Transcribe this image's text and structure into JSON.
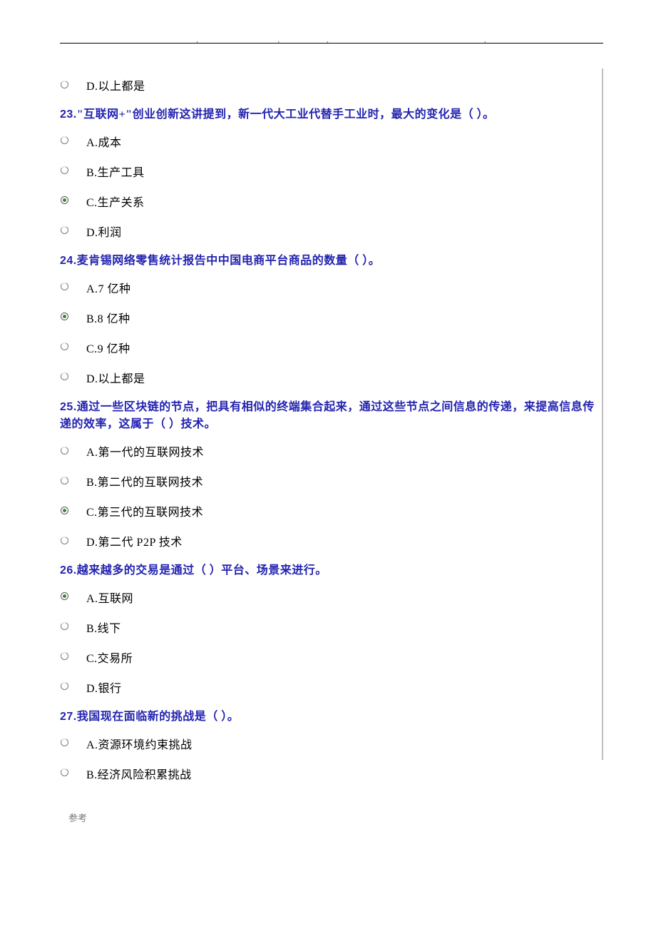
{
  "header": {
    "dots": [
      "·",
      "·",
      "·",
      "·"
    ]
  },
  "prev_tail_option": {
    "label": "D.以上都是",
    "selected": false
  },
  "questions": [
    {
      "num": "23.",
      "text": "\"互联网+\"创业创新这讲提到，新一代大工业代替手工业时，最大的变化是（ ）。",
      "options": [
        {
          "label": "A.成本",
          "selected": false
        },
        {
          "label": "B.生产工具",
          "selected": false
        },
        {
          "label": "C.生产关系",
          "selected": true
        },
        {
          "label": "D.利润",
          "selected": false
        }
      ]
    },
    {
      "num": "24.",
      "text": "麦肯锡网络零售统计报告中中国电商平台商品的数量（ ）。",
      "options": [
        {
          "label": "A.7 亿种",
          "selected": false
        },
        {
          "label": "B.8 亿种",
          "selected": true
        },
        {
          "label": "C.9 亿种",
          "selected": false
        },
        {
          "label": "D.以上都是",
          "selected": false
        }
      ]
    },
    {
      "num": "25.",
      "text": "通过一些区块链的节点，把具有相似的终端集合起来，通过这些节点之间信息的传递，来提高信息传递的效率，这属于（ ）技术。",
      "options": [
        {
          "label": "A.第一代的互联网技术",
          "selected": false
        },
        {
          "label": "B.第二代的互联网技术",
          "selected": false
        },
        {
          "label": "C.第三代的互联网技术",
          "selected": true
        },
        {
          "label": "D.第二代 P2P 技术",
          "selected": false
        }
      ]
    },
    {
      "num": "26.",
      "text": "越来越多的交易是通过（ ）平台、场景来进行。",
      "options": [
        {
          "label": "A.互联网",
          "selected": true
        },
        {
          "label": "B.线下",
          "selected": false
        },
        {
          "label": "C.交易所",
          "selected": false
        },
        {
          "label": "D.银行",
          "selected": false
        }
      ]
    },
    {
      "num": "27.",
      "text": "我国现在面临新的挑战是（ ）。",
      "options": [
        {
          "label": "A.资源环境约束挑战",
          "selected": false
        },
        {
          "label": "B.经济风险积累挑战",
          "selected": false
        }
      ]
    }
  ],
  "footer": {
    "text": "参考"
  },
  "svg": {
    "unchecked": "<svg width='13' height='13' viewBox='0 0 13 13'><circle cx='6.5' cy='6.5' r='5' fill='#fff' stroke='#7a7a7a' stroke-width='1'/><path d='M2.5 3.5 A5 5 0 0 1 9 2' stroke='#e8e8e8' stroke-width='1' fill='none'/></svg>",
    "checked": "<svg width='13' height='13' viewBox='0 0 13 13'><circle cx='6.5' cy='6.5' r='5' fill='#fff' stroke='#5a5a5a' stroke-width='1'/><circle cx='6.5' cy='6.5' r='2.4' fill='#3a7a3a'/></svg>"
  }
}
